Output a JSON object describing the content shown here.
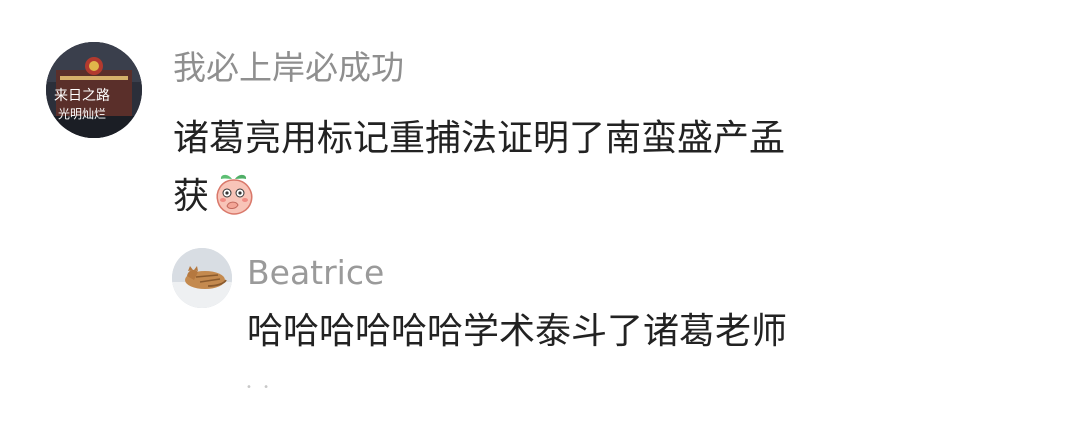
{
  "comment": {
    "username": "我必上岸必成功",
    "text_line1": "诸葛亮用标记重捕法证明了南蛮盛产孟",
    "text_line2": "获",
    "emoji": "peach-covering-mouth-emoji",
    "avatar_text": "来日之路 光明灿烂"
  },
  "reply": {
    "username": "Beatrice",
    "text": "哈哈哈哈哈哈学术泰斗了诸葛老师",
    "avatar": "sleeping-cat-avatar"
  }
}
